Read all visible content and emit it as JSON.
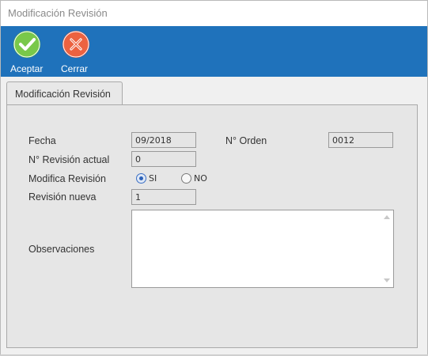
{
  "window": {
    "title": "Modificación Revisión"
  },
  "toolbar": {
    "accept_label": "Aceptar",
    "close_label": "Cerrar",
    "accept_icon": "check-icon",
    "close_icon": "close-icon",
    "accept_color": "#6cbf3a",
    "close_color": "#e8563a"
  },
  "tab": {
    "label": "Modificación Revisión"
  },
  "form": {
    "fecha_label": "Fecha",
    "fecha_value": "09/2018",
    "orden_label": "N° Orden",
    "orden_value": "0012",
    "revision_actual_label": "N° Revisión actual",
    "revision_actual_value": "0",
    "modifica_label": "Modifica Revisión",
    "si_label": "SI",
    "no_label": "NO",
    "modifica_selected": "SI",
    "revision_nueva_label": "Revisión nueva",
    "revision_nueva_value": "1",
    "observaciones_label": "Observaciones",
    "observaciones_value": ""
  },
  "colors": {
    "toolbar_bg": "#1f72bb",
    "panel_bg": "#e6e6e6"
  }
}
